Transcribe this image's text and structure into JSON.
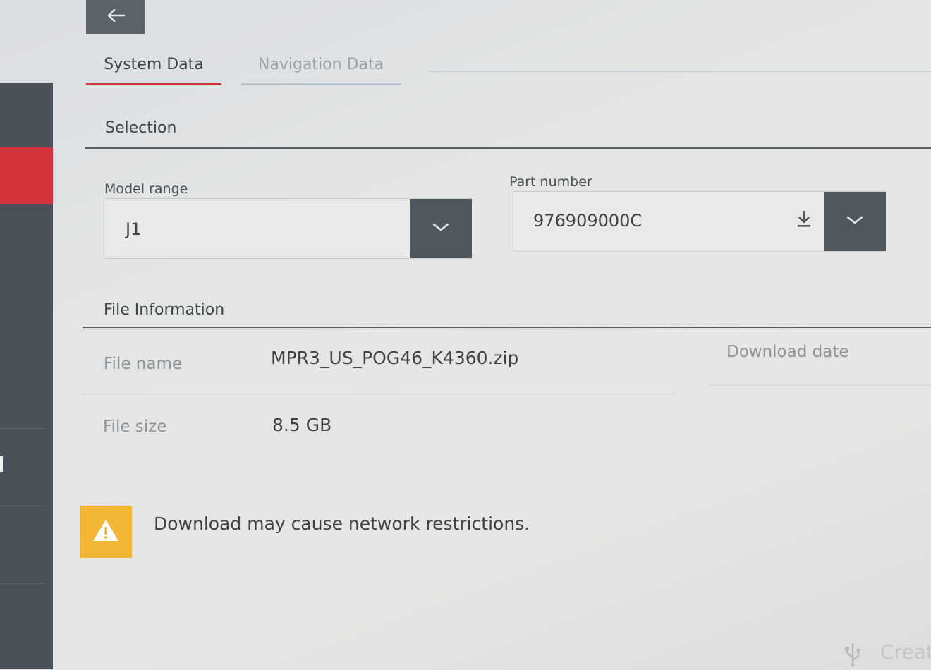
{
  "tabs": [
    {
      "label": "System Data",
      "active": true
    },
    {
      "label": "Navigation Data",
      "active": false
    }
  ],
  "selection": {
    "title": "Selection",
    "model_range": {
      "label": "Model range",
      "value": "J1"
    },
    "part_number": {
      "label": "Part number",
      "value": "976909000C"
    }
  },
  "file_info": {
    "title": "File Information",
    "file_name_label": "File name",
    "file_name_value": "MPR3_US_POG46_K4360.zip",
    "download_date_label": "Download date",
    "file_size_label": "File size",
    "file_size_value": "8.5 GB"
  },
  "warning": {
    "text": "Download may cause network restrictions."
  },
  "footer": {
    "create_label": "Creat"
  },
  "icons": {
    "back": "arrow-left-icon",
    "dropdown": "chevron-down-icon",
    "download": "download-icon",
    "warning": "warning-triangle-icon",
    "usb": "usb-icon"
  },
  "colors": {
    "accent": "#d3333b",
    "rail": "#4b5158",
    "button": "#4f575f",
    "warning": "#f2b634"
  }
}
